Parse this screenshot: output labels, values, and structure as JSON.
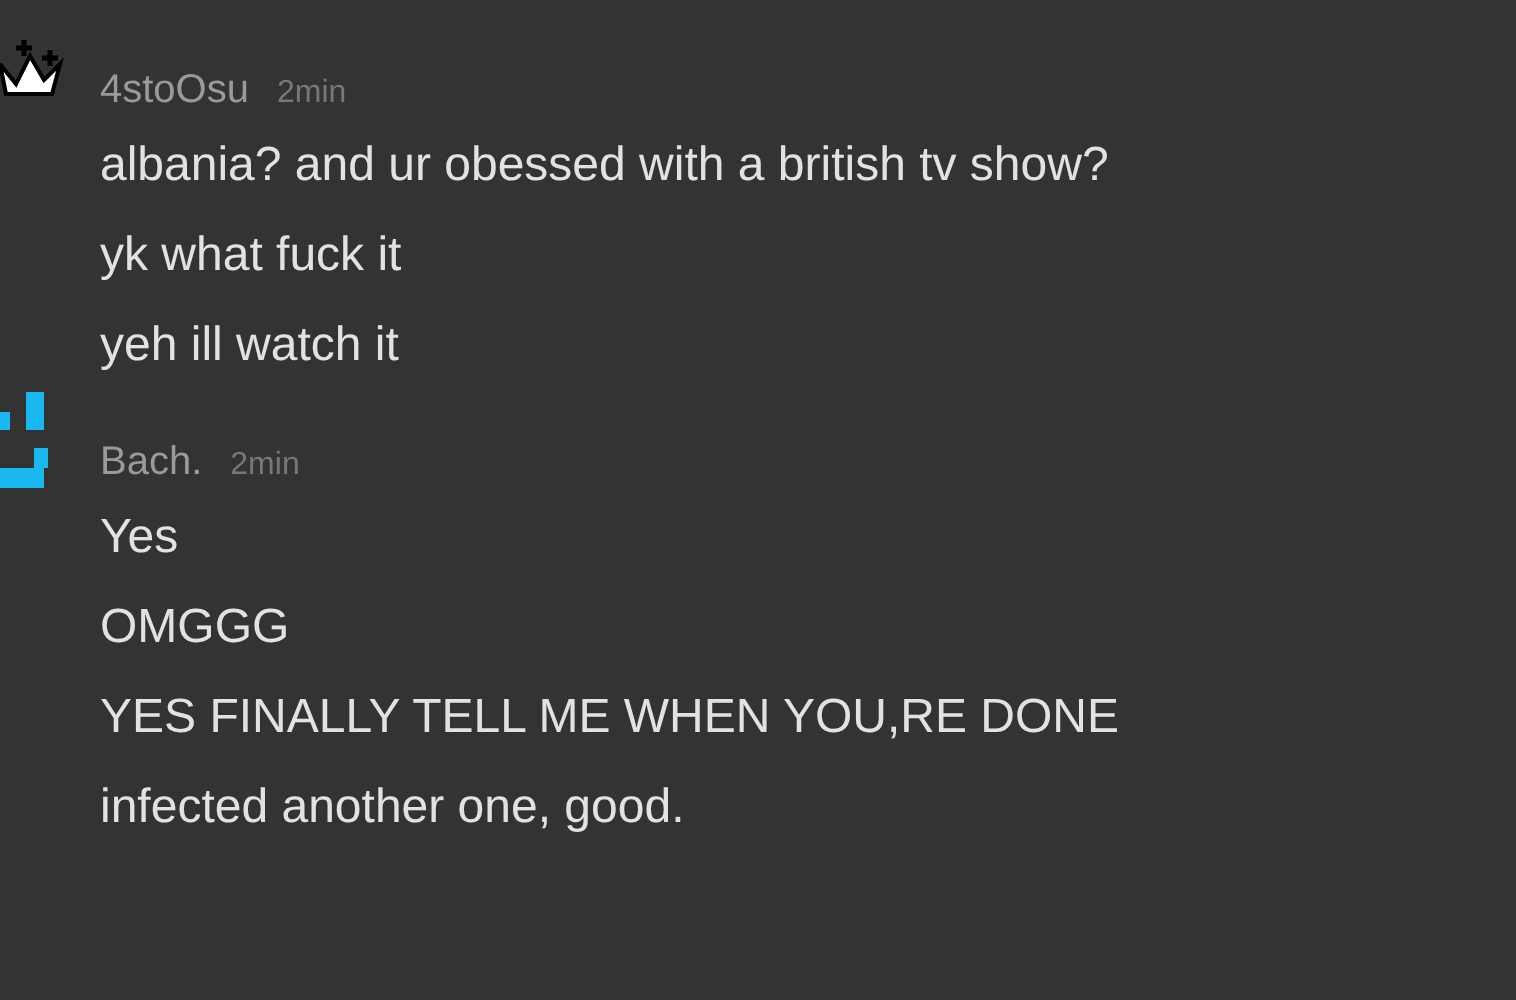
{
  "messages": [
    {
      "author": "4stoOsu",
      "time": "2min",
      "avatar": {
        "kind": "crown"
      },
      "lines": [
        "albania? and ur obessed with a british tv show?",
        "yk what fuck it",
        "yeh ill watch it"
      ]
    },
    {
      "author": "Bach.",
      "time": "2min",
      "avatar": {
        "kind": "pixel-face"
      },
      "lines": [
        "Yes",
        "OMGGG",
        "YES FINALLY TELL ME WHEN YOU,RE DONE",
        "infected another one, good."
      ]
    }
  ]
}
